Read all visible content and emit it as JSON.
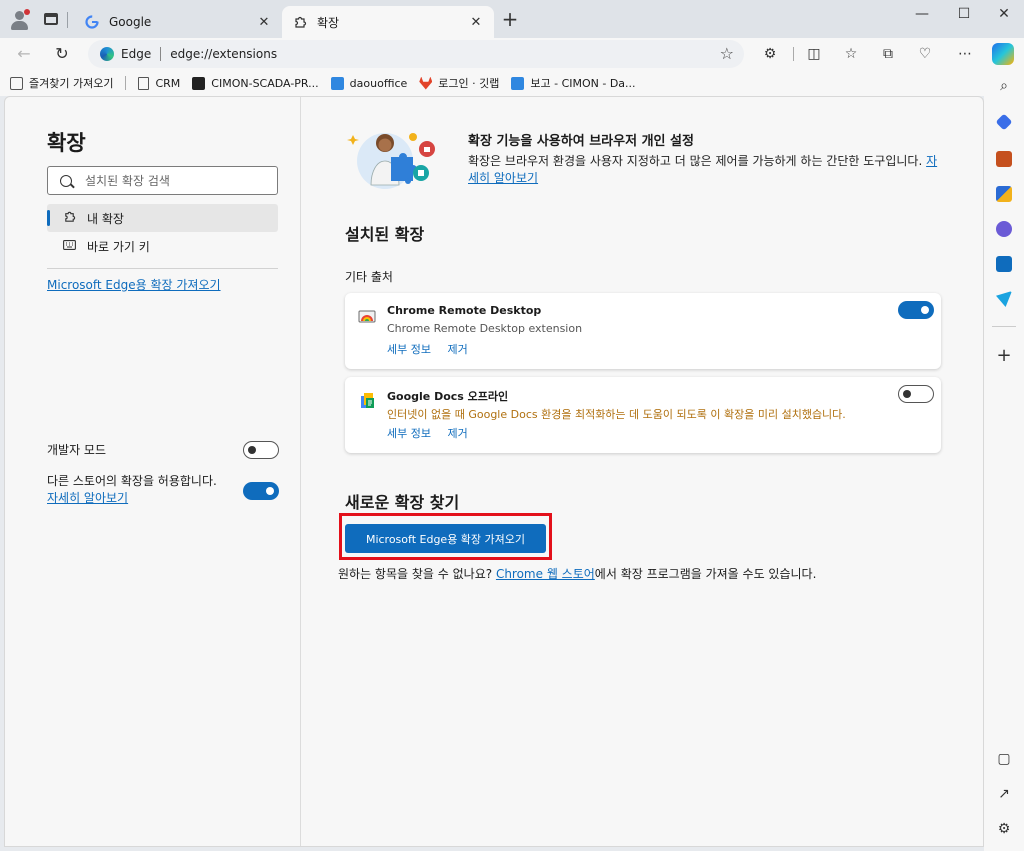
{
  "tabs": [
    {
      "title": "Google",
      "icon": "google-icon",
      "active": false
    },
    {
      "title": "확장",
      "icon": "extensions-icon",
      "active": true
    }
  ],
  "address": {
    "site_label": "Edge",
    "url": "edge://extensions"
  },
  "favorites": [
    {
      "label": "즐겨찾기 가져오기",
      "icon": "import-favorites-icon"
    },
    {
      "label": "CRM",
      "icon": "document-icon"
    },
    {
      "label": "CIMON-SCADA-PR...",
      "icon": "scada-icon"
    },
    {
      "label": "daouoffice",
      "icon": "daou-icon"
    },
    {
      "label": "로그인 · 깃랩",
      "icon": "gitlab-icon"
    },
    {
      "label": "보고 - CIMON - Da...",
      "icon": "daou-icon"
    }
  ],
  "sidebar": {
    "title": "확장",
    "search_placeholder": "설치된 확장 검색",
    "items": [
      {
        "label": "내 확장",
        "icon": "puzzle-icon",
        "selected": true
      },
      {
        "label": "바로 가기 키",
        "icon": "keyboard-icon",
        "selected": false
      }
    ],
    "store_link": "Microsoft Edge용 확장 가져오기",
    "dev_mode_label": "개발자 모드",
    "dev_mode_on": false,
    "allow_other_stores_label": "다른 스토어의 확장을 허용합니다.",
    "allow_other_stores_on": true,
    "learn_more": "자세히 알아보기"
  },
  "main": {
    "hero_title": "확장 기능을 사용하여 브라우저 개인 설정",
    "hero_desc": "확장은 브라우저 환경을 사용자 지정하고 더 많은 제어를 가능하게 하는 간단한 도구입니다.",
    "hero_link": "자세히 알아보기",
    "installed_heading": "설치된 확장",
    "source_label": "기타 출처",
    "extensions": [
      {
        "name": "Chrome Remote Desktop",
        "description": "Chrome Remote Desktop extension",
        "details": "세부 정보",
        "remove": "제거",
        "enabled": true
      },
      {
        "name": "Google Docs 오프라인",
        "description": "인터넷이 없을 때 Google Docs 환경을 최적화하는 데 도움이 되도록 이 확장을 미리 설치했습니다.",
        "details": "세부 정보",
        "remove": "제거",
        "enabled": false
      }
    ],
    "find_heading": "새로운 확장 찾기",
    "get_button": "Microsoft Edge용 확장 가져오기",
    "cant_find_prefix": "원하는 항목을 찾을 수 없나요?",
    "chrome_store_link": "Chrome 웹 스토어",
    "cant_find_suffix": "에서 확장 프로그램을 가져올 수도 있습니다."
  },
  "colors": {
    "accent": "#0f6cbd",
    "highlight_frame": "#e3101a"
  }
}
